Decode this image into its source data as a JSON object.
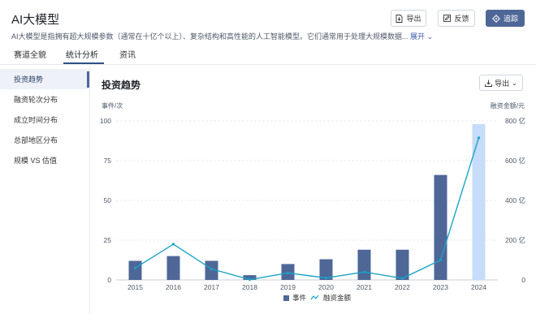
{
  "header": {
    "title": "AI大模型",
    "description": "AI大模型是指拥有超大规模参数（通常在十亿个以上）、复杂结构和高性能的人工智能模型。它们通常用于处理大规模数据...",
    "expand_label": "展开",
    "export_label": "导出",
    "feedback_label": "反馈",
    "follow_label": "追踪"
  },
  "tabs": [
    {
      "label": "赛道全貌"
    },
    {
      "label": "统计分析"
    },
    {
      "label": "资讯"
    }
  ],
  "sidebar": {
    "items": [
      {
        "label": "投资趋势"
      },
      {
        "label": "融资轮次分布"
      },
      {
        "label": "成立时间分布"
      },
      {
        "label": "总部地区分布"
      },
      {
        "label": "规模 VS 估值"
      }
    ]
  },
  "chart_panel": {
    "title": "投资趋势",
    "export_label": "导出"
  },
  "chart_data": {
    "type": "bar",
    "categories": [
      "2015",
      "2016",
      "2017",
      "2018",
      "2019",
      "2020",
      "2021",
      "2022",
      "2023",
      "2024"
    ],
    "left_unit": "事件/次",
    "right_unit": "融资金额/元",
    "left_ticks": [
      "0",
      "25",
      "50",
      "75",
      "100"
    ],
    "right_ticks": [
      "0",
      "200 亿",
      "400 亿",
      "600 亿",
      "800 亿"
    ],
    "ylim": [
      0,
      100
    ],
    "y2lim": [
      0,
      800
    ],
    "series": [
      {
        "name": "事件",
        "type": "bar",
        "values": [
          12,
          15,
          12,
          3,
          10,
          13,
          19,
          19,
          66,
          98
        ],
        "color": "#4e6797",
        "highlight_last_color": "#c6dcfa"
      },
      {
        "name": "融资金额",
        "type": "line",
        "values": [
          60,
          180,
          55,
          2,
          35,
          10,
          40,
          8,
          100,
          715
        ],
        "color": "#1aa3c7"
      }
    ],
    "grid": true,
    "legend": "bottom-center"
  },
  "colors": {
    "accent": "#4e6797",
    "line": "#1aa3c7",
    "bar_highlight": "#c6dcfa"
  }
}
